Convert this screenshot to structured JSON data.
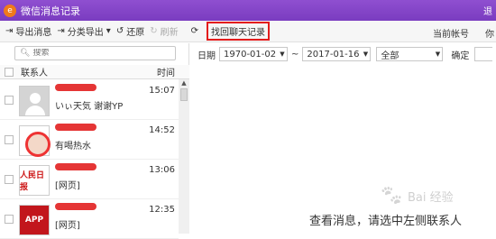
{
  "window": {
    "title": "微信消息记录",
    "right_label": "退"
  },
  "toolbar": {
    "export_msg": "导出消息",
    "export_category": "分类导出",
    "restore": "还原",
    "refresh": "刷新",
    "recover": "找回聊天记录",
    "account_label": "当前帐号",
    "account_value": "你"
  },
  "search": {
    "placeholder": "搜索"
  },
  "list": {
    "col_contact": "联系人",
    "col_time": "时间",
    "rows": [
      {
        "time": "15:07",
        "preview": "いぃ天気 谢谢YP",
        "avatar": "default-avatar"
      },
      {
        "time": "14:52",
        "preview": "有喝热水",
        "avatar": "cartoon-avatar"
      },
      {
        "time": "13:06",
        "preview": "[网页]",
        "avatar_text": "人民日报"
      },
      {
        "time": "12:35",
        "preview": "[网页]",
        "avatar_text": "APP"
      }
    ]
  },
  "filter": {
    "date_label": "日期",
    "date_from": "1970-01-02",
    "separator": "~",
    "date_to": "2017-01-16",
    "type": "全部",
    "confirm": "确定"
  },
  "hint": "查看消息，请选中左侧联系人",
  "watermark": {
    "text": "Bai 经验"
  }
}
